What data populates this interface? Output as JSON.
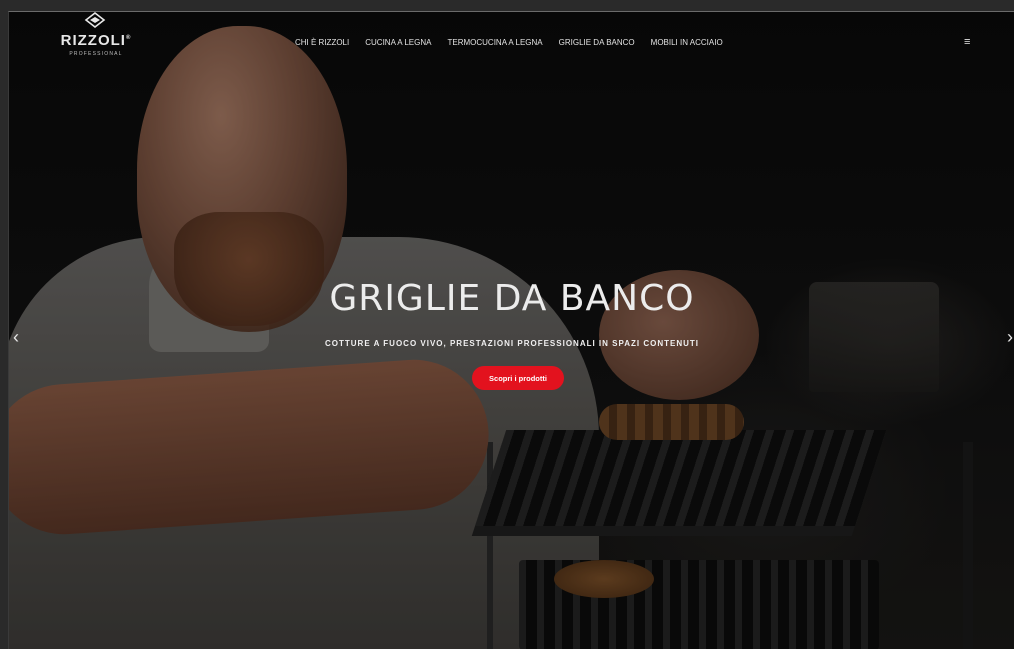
{
  "brand": {
    "name": "RIZZOLI",
    "registered_mark": "®",
    "tagline": "PROFESSIONAL"
  },
  "nav": {
    "items": [
      {
        "label": "CHI È RIZZOLI"
      },
      {
        "label": "CUCINA A LEGNA"
      },
      {
        "label": "TERMOCUCINA A LEGNA"
      },
      {
        "label": "GRIGLIE DA BANCO"
      },
      {
        "label": "MOBILI IN ACCIAIO"
      }
    ],
    "menu_icon": "hamburger-icon"
  },
  "hero": {
    "title": "GRIGLIE DA BANCO",
    "subtitle": "COTTURE A FUOCO VIVO, PRESTAZIONI PROFESSIONALI IN SPAZI CONTENUTI",
    "cta_label": "Scopri i prodotti",
    "prev_icon": "chevron-left-icon",
    "next_icon": "chevron-right-icon"
  },
  "colors": {
    "accent": "#e3121e",
    "text": "#ececec",
    "background": "#0b0b0b"
  }
}
